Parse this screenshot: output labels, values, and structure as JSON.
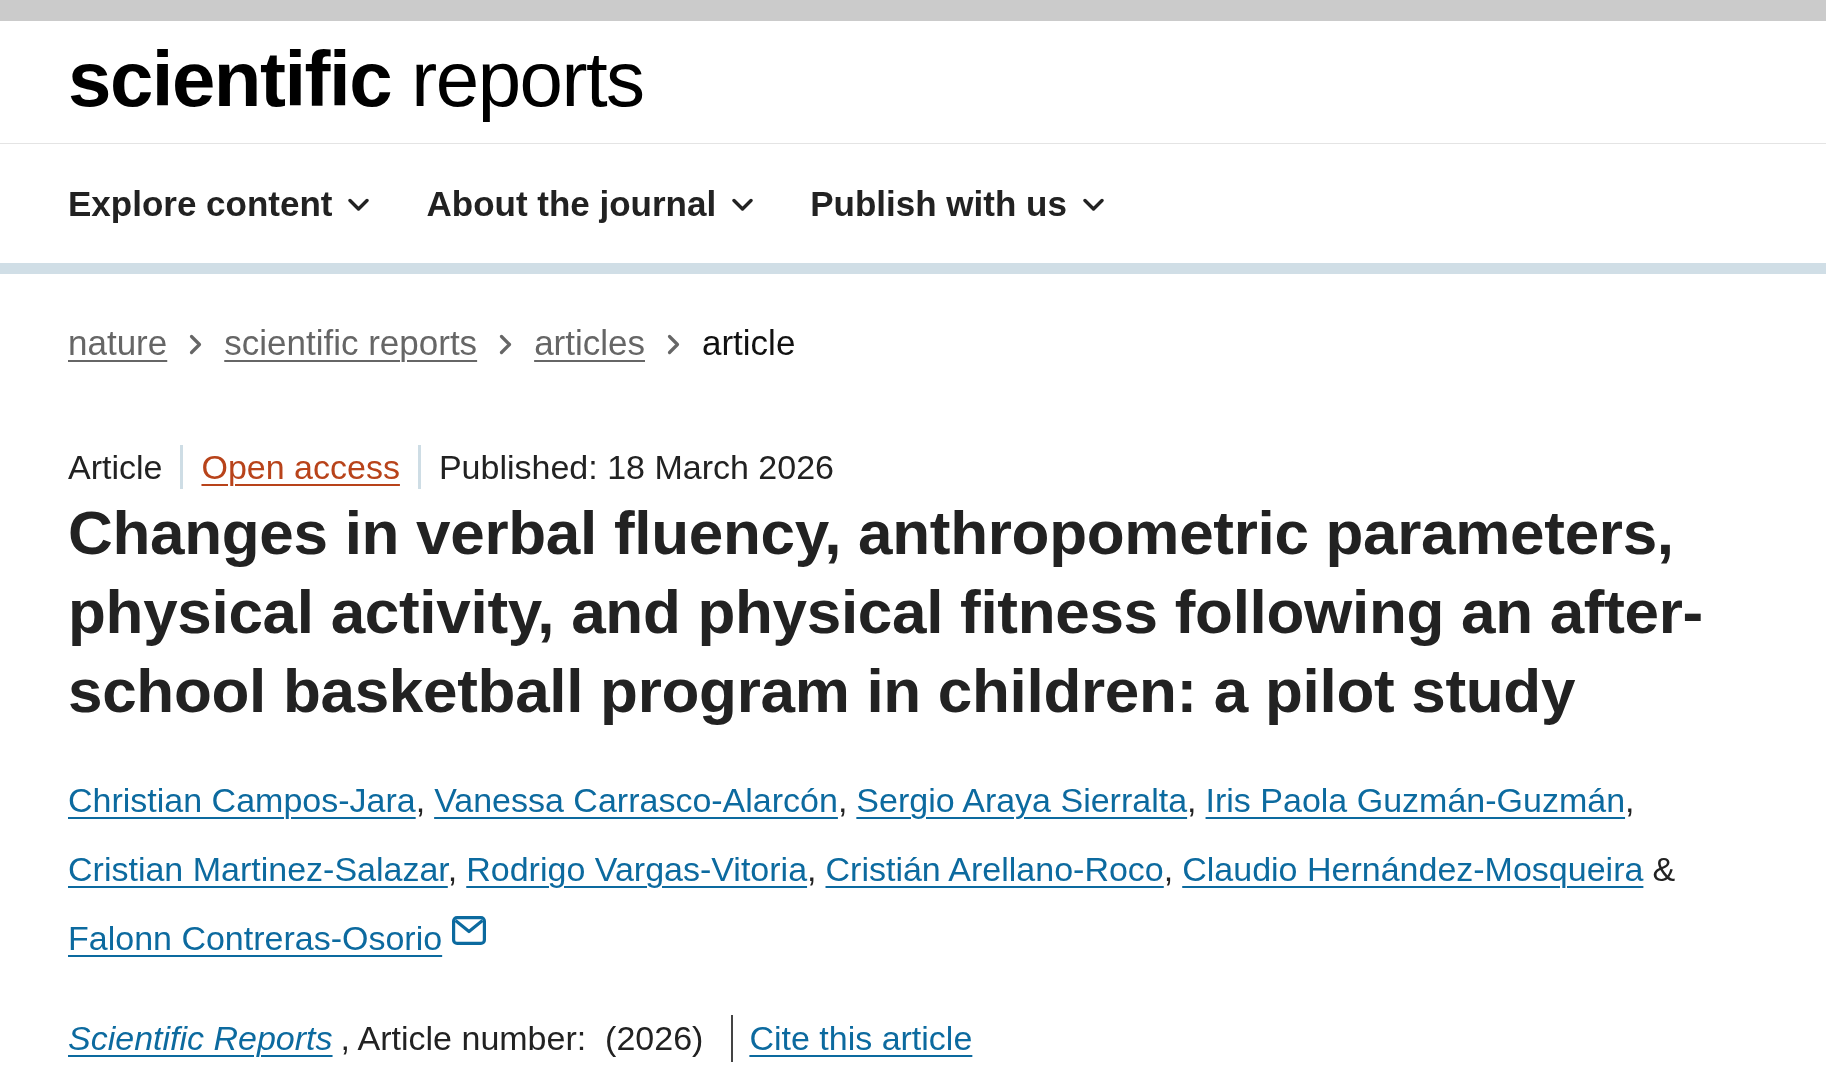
{
  "logo": "**scientific** reports",
  "nav": [
    {
      "label": "Explore content",
      "expanded": false
    },
    {
      "label": "About the journal",
      "expanded": false
    },
    {
      "label": "Publish with us",
      "expanded": false
    }
  ],
  "breadcrumbs": [
    {
      "label": "nature",
      "current": false
    },
    {
      "label": "scientific reports",
      "current": false
    },
    {
      "label": "articles",
      "current": false
    },
    {
      "label": "article",
      "current": true
    }
  ],
  "article": {
    "type": "Article",
    "access": "Open access",
    "published": "Published: 18 March 2026",
    "title": "Changes in verbal fluency, anthropometric parameters, physical activity, and physical fitness following an after-school basketball program in children: a pilot study",
    "authors": [
      {
        "name": "Christian Campos-Jara",
        "suffix": ",",
        "email": false
      },
      {
        "name": "Vanessa Carrasco-Alarcón",
        "suffix": ",",
        "email": false
      },
      {
        "name": "Sergio Araya Sierralta",
        "suffix": ",",
        "email": false
      },
      {
        "name": "Iris Paola Guzmán-Guzmán",
        "suffix": ",",
        "email": false
      },
      {
        "name": "Cristian Martinez-Salazar",
        "suffix": ",",
        "email": false
      },
      {
        "name": "Rodrigo Vargas-Vitoria",
        "suffix": ",",
        "email": false
      },
      {
        "name": "Cristián Arellano-Roco",
        "suffix": ",",
        "email": false
      },
      {
        "name": "Claudio Hernández-Mosqueira",
        "suffix": "&",
        "email": false
      },
      {
        "name": "Falonn Contreras-Osorio",
        "email": true
      }
    ],
    "journal": "Scientific Reports",
    "citation": ", Article number:  (2026)",
    "cite_link": "Cite this article"
  }
}
